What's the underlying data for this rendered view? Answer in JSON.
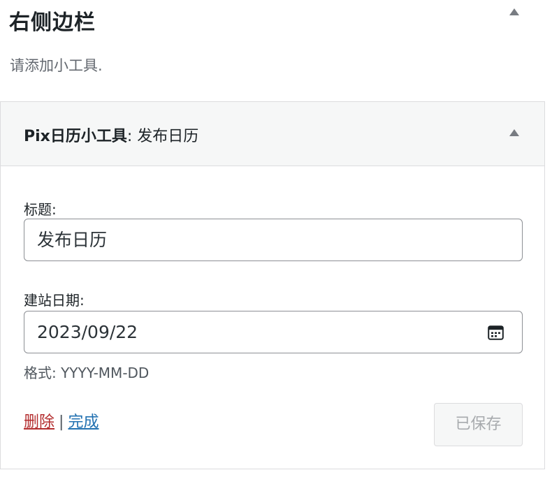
{
  "sidebar": {
    "title": "右侧边栏",
    "description": "请添加小工具."
  },
  "widget": {
    "name": "Pix日历小工具",
    "separator": ": ",
    "instance_title": "发布日历",
    "fields": {
      "title_label": "标题:",
      "title_value": "发布日历",
      "date_label": "建站日期:",
      "date_value": "2023/09/22",
      "format_hint": "格式: YYYY-MM-DD"
    },
    "controls": {
      "delete_label": "删除",
      "divider": "|",
      "done_label": "完成",
      "saved_label": "已保存"
    }
  },
  "icons": {
    "collapse": "triangle-up-icon",
    "calendar": "calendar-icon"
  },
  "colors": {
    "delete": "#b32d2e",
    "link": "#2271b1",
    "disabled_text": "#a7aaad",
    "header_bg": "#f6f7f7"
  }
}
